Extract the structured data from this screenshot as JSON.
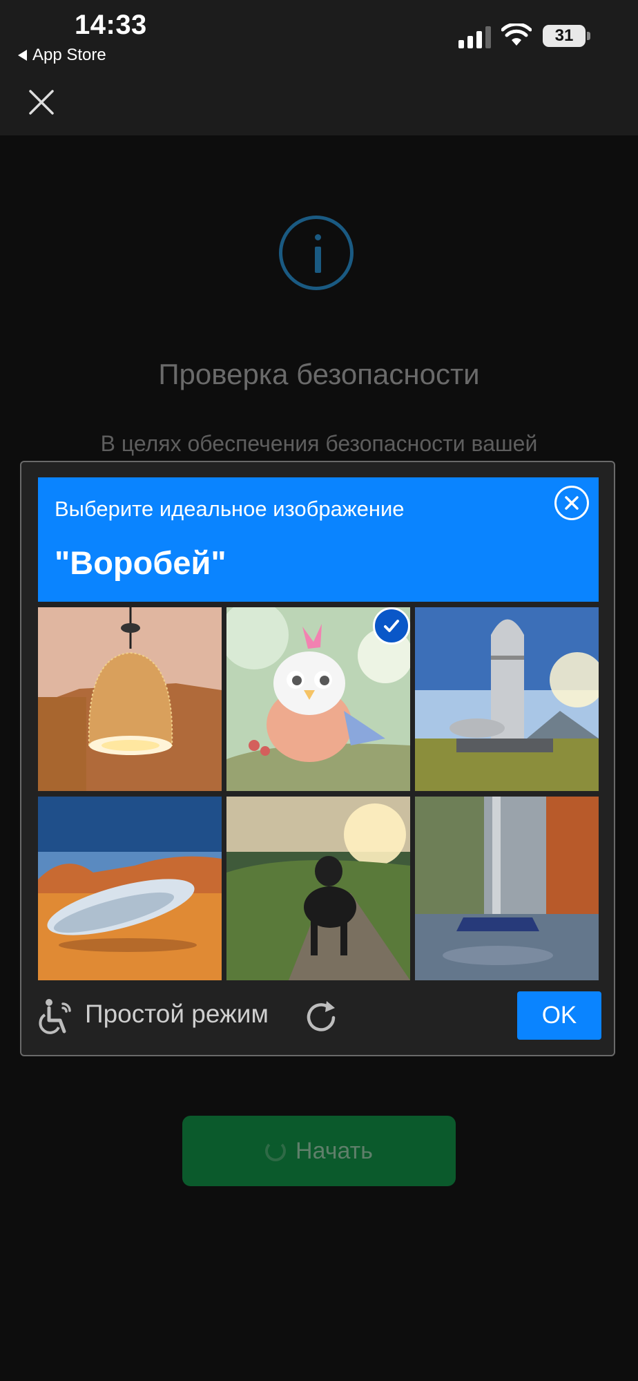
{
  "status_bar": {
    "time": "14:33",
    "back_label": "App Store",
    "battery": "31"
  },
  "page": {
    "title": "Проверка безопасности",
    "description": "В целях обеспечения безопасности вашей",
    "start_button": "Начать"
  },
  "captcha": {
    "instruction": "Выберите идеальное изображение",
    "target": "\"Воробей\"",
    "tiles": [
      {
        "icon": "lamp-image",
        "selected": false
      },
      {
        "icon": "cartoon-bird-image",
        "selected": true
      },
      {
        "icon": "rocket-image",
        "selected": false
      },
      {
        "icon": "capsule-desert-image",
        "selected": false
      },
      {
        "icon": "dog-image",
        "selected": false
      },
      {
        "icon": "vacuum-image",
        "selected": false
      }
    ],
    "simple_mode_label": "Простой режим",
    "ok_label": "OK"
  },
  "colors": {
    "accent": "#0a84ff",
    "start_button": "#0b5a2c",
    "info_icon": "#1a5a82"
  }
}
